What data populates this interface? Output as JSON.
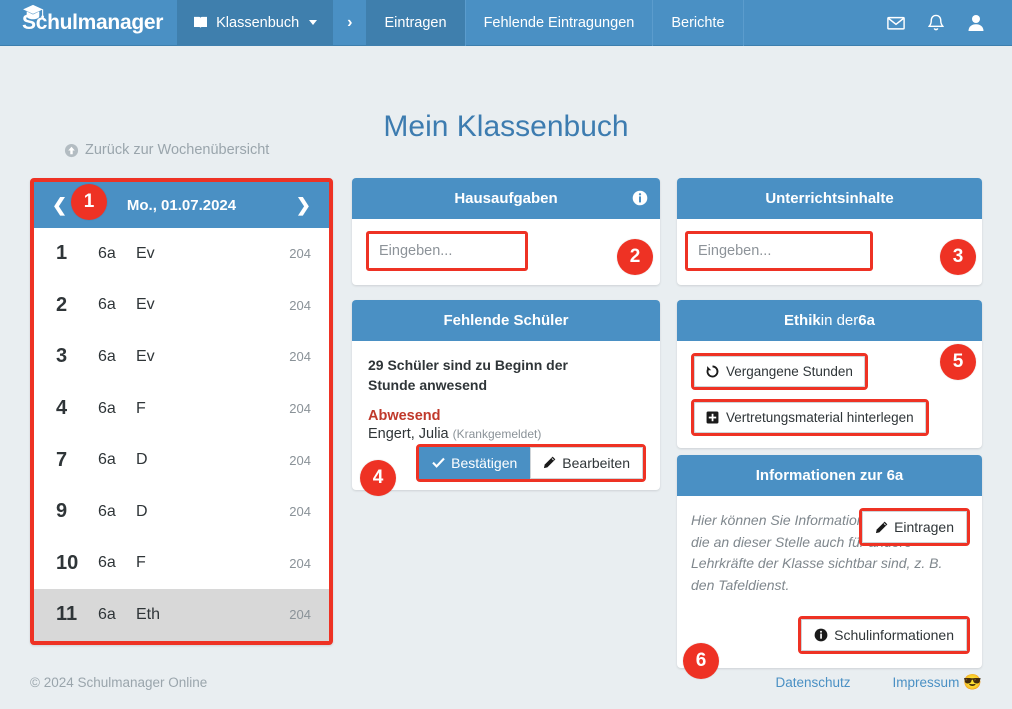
{
  "navbar": {
    "brand": "Schulmanager",
    "brand_icon": "graduation-cap-icon",
    "module": {
      "label": "Klassenbuch",
      "icon": "book-icon",
      "caret": "caret-down-icon"
    },
    "separator": "›",
    "tabs": [
      {
        "label": "Eintragen",
        "active": true
      },
      {
        "label": "Fehlende Eintragungen",
        "active": false
      },
      {
        "label": "Berichte",
        "active": false
      }
    ],
    "icons": {
      "mail": "envelope-icon",
      "bell": "bell-icon",
      "user": "user-icon",
      "user_caret": "caret-down-icon"
    }
  },
  "page": {
    "title": "Mein Klassenbuch",
    "back_link": {
      "label": "Zurück zur Wochenübersicht",
      "icon": "arrow-circle-up-icon"
    }
  },
  "lesson_panel": {
    "prev_icon": "chevron-left-icon",
    "next_icon": "chevron-right-icon",
    "date": "Mo., 01.07.2024",
    "rows": [
      {
        "no": "1",
        "class": "6a",
        "subject": "Ev",
        "room": "204",
        "selected": false
      },
      {
        "no": "2",
        "class": "6a",
        "subject": "Ev",
        "room": "204",
        "selected": false
      },
      {
        "no": "3",
        "class": "6a",
        "subject": "Ev",
        "room": "204",
        "selected": false
      },
      {
        "no": "4",
        "class": "6a",
        "subject": "F",
        "room": "204",
        "selected": false
      },
      {
        "no": "7",
        "class": "6a",
        "subject": "D",
        "room": "204",
        "selected": false
      },
      {
        "no": "9",
        "class": "6a",
        "subject": "D",
        "room": "204",
        "selected": false
      },
      {
        "no": "10",
        "class": "6a",
        "subject": "F",
        "room": "204",
        "selected": false
      },
      {
        "no": "11",
        "class": "6a",
        "subject": "Eth",
        "room": "204",
        "selected": true
      }
    ]
  },
  "hausaufgaben": {
    "title": "Hausaufgaben",
    "info_icon": "info-circle-icon",
    "input_placeholder": "Eingeben...",
    "input_value": ""
  },
  "unterrichtsinhalte": {
    "title": "Unterrichtsinhalte",
    "input_placeholder": "Eingeben...",
    "input_value": ""
  },
  "fehlende_schueler": {
    "title": "Fehlende Schüler",
    "summary": "29 Schüler sind zu Beginn der Stunde anwesend",
    "absent_heading": "Abwesend",
    "absent_name": "Engert, Julia",
    "absent_note": "(Krankgemeldet)",
    "confirm_button": {
      "label": "Bestätigen",
      "icon": "check-icon"
    },
    "edit_button": {
      "label": "Bearbeiten",
      "icon": "pencil-icon"
    }
  },
  "ethik": {
    "title_subject": "Ethik",
    "title_rest": " in der ",
    "title_class": "6a",
    "past_lessons_button": {
      "label": "Vergangene Stunden",
      "icon": "history-icon"
    },
    "material_button": {
      "label": "Vertretungsmaterial hinterlegen",
      "icon": "plus-square-icon"
    }
  },
  "informationen": {
    "title": "Informationen zur 6a",
    "placeholder_text": "Hier können Sie Informationen eintragen, die an dieser Stelle auch für andere Lehrkräfte der Klasse sichtbar sind, z. B. den Tafeldienst.",
    "eintragen_button": {
      "label": "Eintragen",
      "icon": "pencil-icon"
    },
    "schulinfo_button": {
      "label": "Schulinformationen",
      "icon": "info-circle-icon"
    }
  },
  "badges": [
    "1",
    "2",
    "3",
    "4",
    "5",
    "6"
  ],
  "footer": {
    "copyright": "© 2024 Schulmanager Online",
    "privacy": "Datenschutz",
    "imprint": "Impressum",
    "imprint_emoji": "😎"
  },
  "colors": {
    "brand_blue": "#4a90c4",
    "dark_blue": "#3f7fad",
    "annotation_red": "#ee3224",
    "page_bg": "#e9eef1",
    "absent_red": "#c0392b",
    "title_blue": "#3d7cb0",
    "muted": "#8a9298"
  }
}
